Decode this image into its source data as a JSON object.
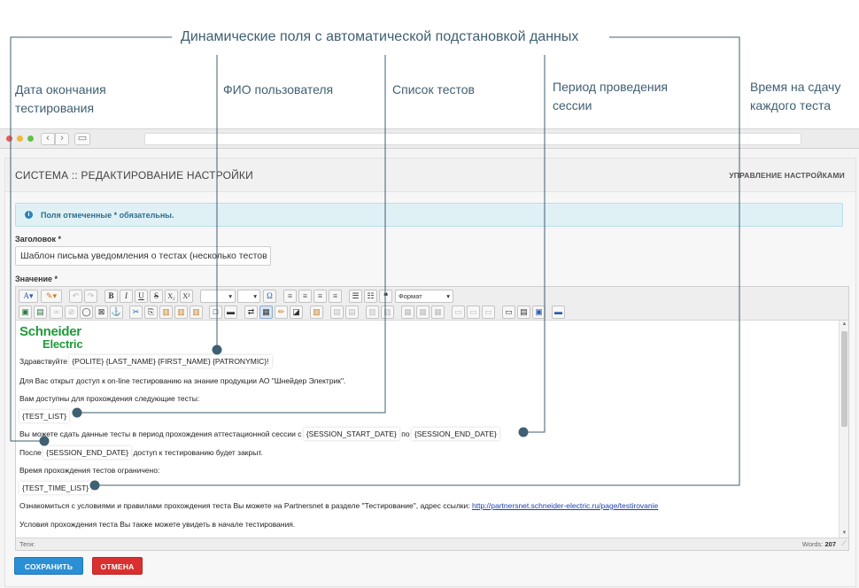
{
  "annotation": {
    "title": "Динамические поля с автоматической подстановкой данных",
    "labels": [
      {
        "line1": "Дата окончания",
        "line2": "тестирования"
      },
      {
        "line1": "ФИО пользователя",
        "line2": ""
      },
      {
        "line1": "Список тестов",
        "line2": ""
      },
      {
        "line1": "Период проведения",
        "line2": "сессии"
      },
      {
        "line1": "Время на сдачу",
        "line2": "каждого теста"
      }
    ]
  },
  "header": {
    "title": "СИСТЕМА :: РЕДАКТИРОВАНИЕ НАСТРОЙКИ",
    "manage_link": "УПРАВЛЕНИЕ НАСТРОЙКАМИ"
  },
  "alert": {
    "text": "Поля отмеченные * обязательны."
  },
  "form": {
    "title_label": "Заголовок *",
    "title_value": "Шаблон письма уведомления о тестах (несколько тестов",
    "value_label": "Значение *"
  },
  "toolbar": {
    "bold": "B",
    "italic": "I",
    "underline": "U",
    "strike": "S",
    "subscript": "X₂",
    "superscript": "X²",
    "omega": "Ω",
    "quote": "❝",
    "format_select": "Формат"
  },
  "editor": {
    "logo_line1": "Schneider",
    "logo_line2": "Electric",
    "greeting": "Здравствуйте",
    "greeting_placeholder": "{POLITE} {LAST_NAME} {FIRST_NAME} {PATRONYMIC}!",
    "access_line": "Для Вас открыт доступ к on-line тестированию на знание продукции АО \"Шнейдер Электрик\".",
    "available_line": "Вам доступны для прохождения следующие тесты:",
    "test_list": "{TEST_LIST}",
    "session_prefix": "Вы можете сдать данные тесты в период прохождения аттестационной сессии с",
    "session_start": "{SESSION_START_DATE}",
    "session_mid": "по",
    "session_end_date": "{SESSION_END_DATE}",
    "after_prefix": "После",
    "session_end": "{SESSION_END_DATE}",
    "after_suffix": "доступ к тестированию будет закрыт.",
    "time_limited": "Время прохождения тестов ограничено:",
    "time_list": "{TEST_TIME_LIST}",
    "rules_prefix": "Ознакомиться с условиями и правилами прохождения теста Вы можете на Partnersnet в разделе \"Тестирование\", адрес ссылки:",
    "rules_link": "http://partnersnet.schneider-electric.ru/page/testirovanie",
    "conditions_line": "Условия прохождения теста Вы также можете увидеть в начале тестирования."
  },
  "statusbar": {
    "tags_label": "Теги:",
    "words_label": "Words:",
    "words_count": "207"
  },
  "buttons": {
    "save": "СОХРАНИТЬ",
    "cancel": "ОТМЕНА"
  },
  "colors": {
    "annotation": "#3f5f72",
    "save": "#2a8fd4",
    "cancel": "#d9302f",
    "logo": "#1f9a3a"
  }
}
